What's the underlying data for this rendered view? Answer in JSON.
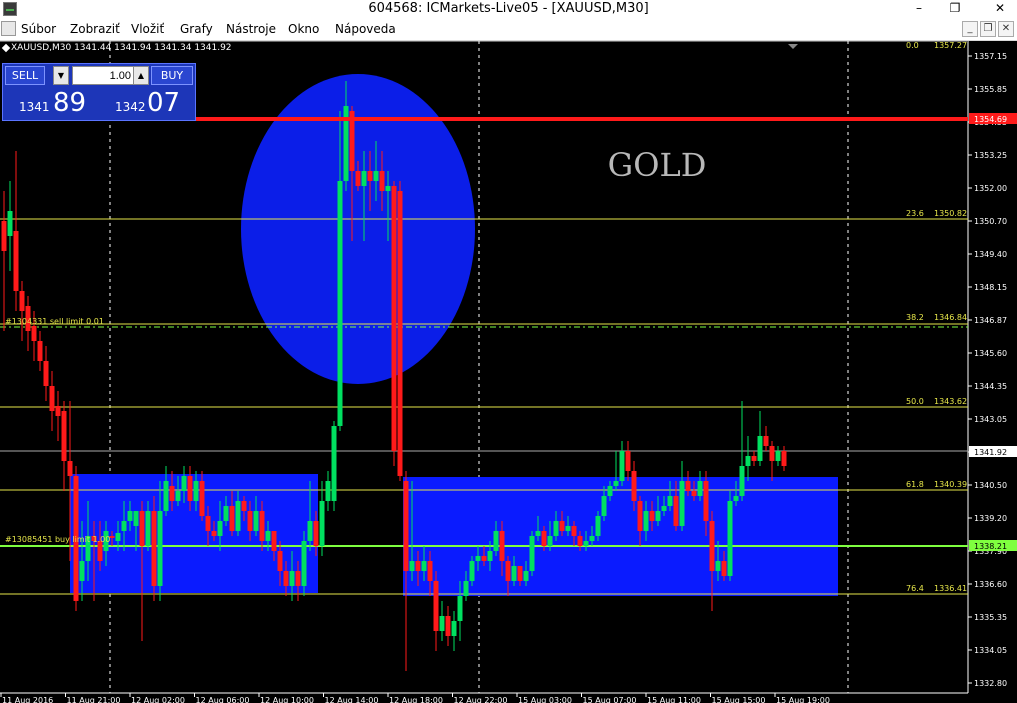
{
  "window": {
    "title": "604568: ICMarkets-Live05 - [XAUUSD,M30]",
    "minimize": "–",
    "restore": "❐",
    "close": "✕"
  },
  "menu": {
    "items": [
      {
        "label": "Súbor"
      },
      {
        "label": "Zobraziť"
      },
      {
        "label": "Vložiť"
      },
      {
        "label": "Grafy"
      },
      {
        "label": "Nástroje"
      },
      {
        "label": "Okno"
      },
      {
        "label": "Nápoveda"
      }
    ],
    "mdi_minimize": "_",
    "mdi_restore": "❐",
    "mdi_close": "✕"
  },
  "chart": {
    "symbol_label": "XAUUSD,M30  1341.44 1341.94 1341.34 1341.92",
    "watermark": "GOLD",
    "colors": {
      "bull": "#00e060",
      "bear": "#ff1a1a",
      "fib": "#e6e64a",
      "order": "#7fff3f",
      "zone": "#0a1bff",
      "ellipse": "#0b1ee8",
      "red_line": "#ff1a1a",
      "grid": "#ffffff"
    },
    "trade_panel": {
      "sell_label": "SELL",
      "buy_label": "BUY",
      "lot": "1.00",
      "sell_price_small": "1341",
      "sell_price_big": "89",
      "buy_price_small": "1342",
      "buy_price_big": "07"
    },
    "price_axis": [
      "1357.15",
      "1355.85",
      "1354.55",
      "1353.25",
      "1352.00",
      "1350.70",
      "1349.40",
      "1348.15",
      "1346.87",
      "1345.60",
      "1344.35",
      "1343.05",
      "1341.75",
      "1340.50",
      "1339.20",
      "1337.90",
      "1336.60",
      "1335.35",
      "1334.05",
      "1332.80"
    ],
    "price_badges": {
      "red": "1354.69",
      "current": "1341.92",
      "green": "1338.21"
    },
    "fib_levels": [
      {
        "ratio": "0.0",
        "price": "1357.27"
      },
      {
        "ratio": "23.6",
        "price": "1350.82"
      },
      {
        "ratio": "38.2",
        "price": "1346.84"
      },
      {
        "ratio": "50.0",
        "price": "1343.62"
      },
      {
        "ratio": "61.8",
        "price": "1340.39"
      },
      {
        "ratio": "76.4",
        "price": "1336.41"
      }
    ],
    "order_labels": {
      "sell_limit": "#1304331 sell limit 0.01",
      "buy_limit": "#13085451 buy limit 1.00"
    },
    "time_axis": [
      "11 Aug 2016",
      "11 Aug 21:00",
      "12 Aug 02:00",
      "12 Aug 06:00",
      "12 Aug 10:00",
      "12 Aug 14:00",
      "12 Aug 18:00",
      "12 Aug 22:00",
      "15 Aug 03:00",
      "15 Aug 07:00",
      "15 Aug 11:00",
      "15 Aug 15:00",
      "15 Aug 19:00"
    ]
  }
}
